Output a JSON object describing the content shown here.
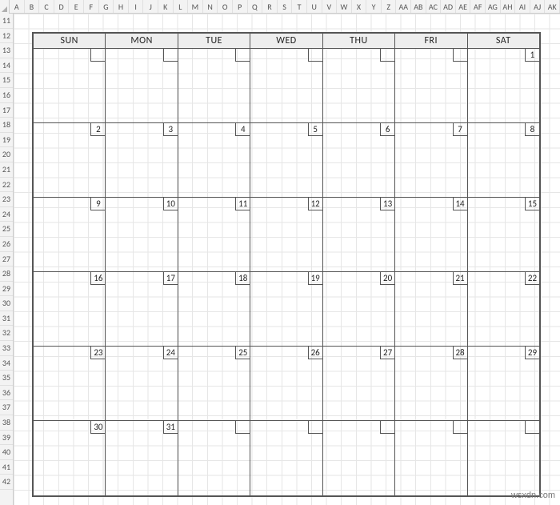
{
  "columns": [
    "A",
    "B",
    "C",
    "D",
    "E",
    "F",
    "G",
    "H",
    "I",
    "J",
    "K",
    "L",
    "M",
    "N",
    "O",
    "P",
    "Q",
    "R",
    "S",
    "T",
    "U",
    "V",
    "W",
    "X",
    "Y",
    "Z",
    "AA",
    "AB",
    "AC",
    "AD",
    "AE",
    "AF",
    "AG",
    "AH",
    "AI",
    "AJ",
    "AK"
  ],
  "rows_start": 11,
  "rows_end": 42,
  "calendar": {
    "headers": [
      "SUN",
      "MON",
      "TUE",
      "WED",
      "THU",
      "FRI",
      "SAT"
    ],
    "weeks": [
      [
        "",
        "",
        "",
        "",
        "",
        "",
        "1"
      ],
      [
        "2",
        "3",
        "4",
        "5",
        "6",
        "7",
        "8"
      ],
      [
        "9",
        "10",
        "11",
        "12",
        "13",
        "14",
        "15"
      ],
      [
        "16",
        "17",
        "18",
        "19",
        "20",
        "21",
        "22"
      ],
      [
        "23",
        "24",
        "25",
        "26",
        "27",
        "28",
        "29"
      ],
      [
        "30",
        "31",
        "",
        "",
        "",
        "",
        ""
      ]
    ]
  },
  "watermark": "wsxdn.com"
}
